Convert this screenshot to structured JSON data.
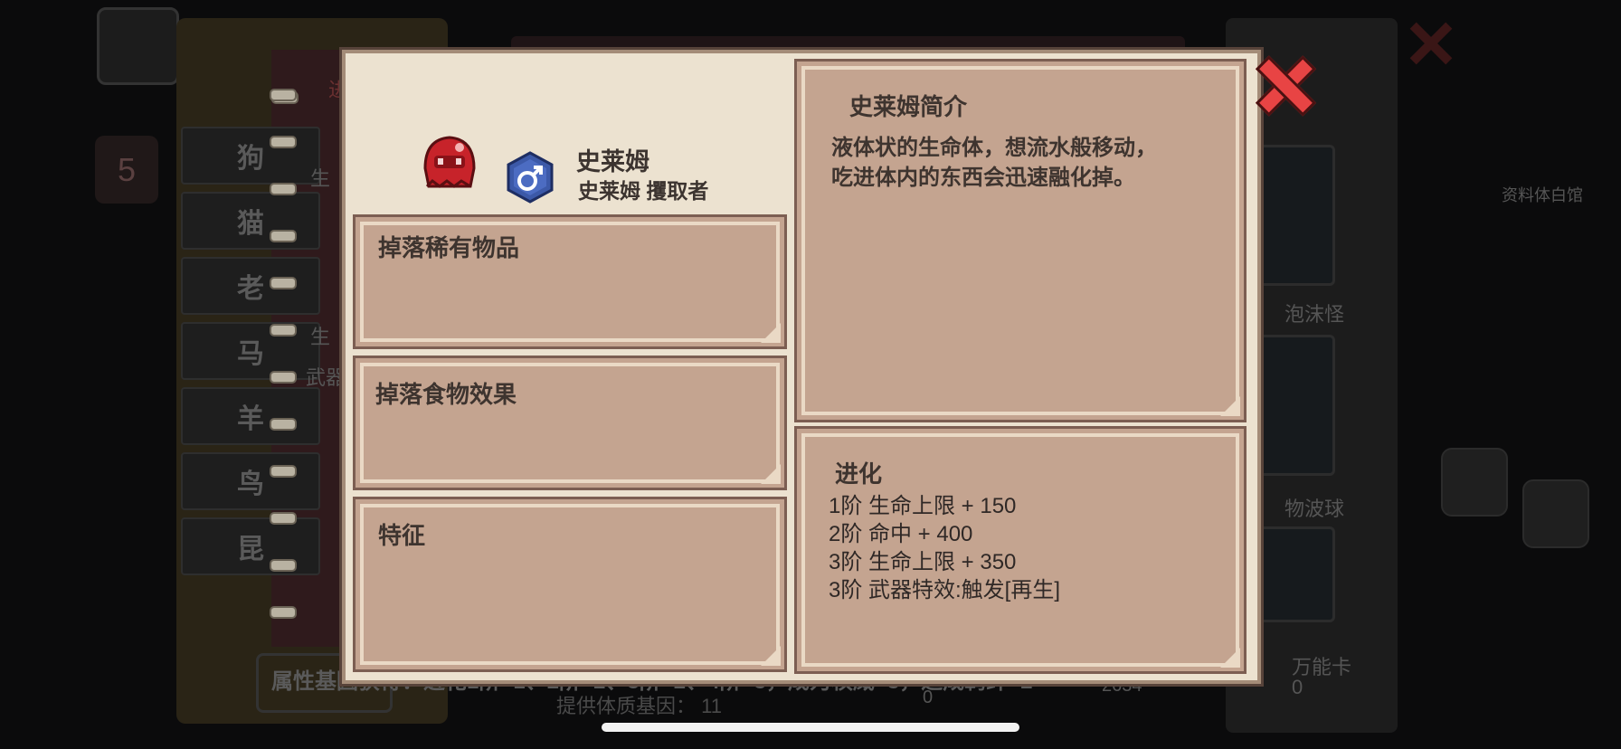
{
  "background": {
    "left_list": [
      "狗",
      "猫",
      "老",
      "马",
      "羊",
      "鸟",
      "昆"
    ],
    "left_tab_label": "进",
    "level_badge": "5",
    "side_labels": [
      "生",
      "生",
      "武器"
    ],
    "right_labels": [
      "泡沫怪",
      "物波球",
      "万能卡",
      "0"
    ],
    "right_top_label": "资料体白馆",
    "bottom_left_text": "属性基因获得：进化1阶+1、2阶+2、3阶+2、4阶+3，成为权威+3，达成羁绊+2",
    "bottom_sub_text": "提供体质基因：   11",
    "bottom_numbers": [
      "0",
      "2634"
    ]
  },
  "monster": {
    "name": "史莱姆",
    "subtitle": "史莱姆 攫取者",
    "gender_icon": "male-symbol-icon",
    "sprite_color": "#c7232a"
  },
  "cards": {
    "rare_drops": {
      "title": "掉落稀有物品"
    },
    "food_effect": {
      "title": "掉落食物效果"
    },
    "traits": {
      "title": "特征"
    },
    "intro": {
      "title": "史莱姆简介",
      "body": "液体状的生命体，想流水般移动，\n吃进体内的东西会迅速融化掉。"
    },
    "evolution": {
      "title": "进化",
      "lines": [
        "1阶 生命上限 + 150",
        "2阶 命中 + 400",
        "3阶 生命上限 + 350",
        "3阶 武器特效:触发[再生]"
      ]
    }
  },
  "colors": {
    "accent_close": "#e84444",
    "card_fill": "#c4a490",
    "modal_bg": "#ece2d0"
  }
}
